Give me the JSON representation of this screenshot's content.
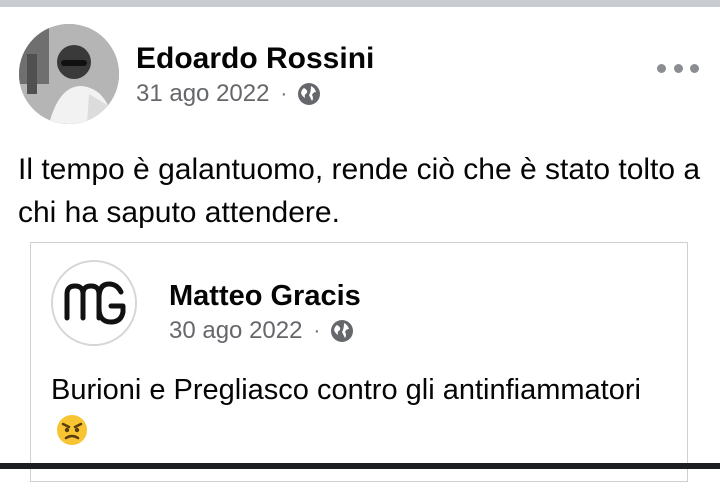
{
  "post": {
    "author": "Edoardo Rossini",
    "date": "31 ago 2022",
    "separator": "·",
    "privacy_icon": "globe-icon",
    "text": "Il tempo è galantuomo, rende ciò che è stato tolto a chi ha saputo attendere.",
    "more_icon": "more-options-icon"
  },
  "shared": {
    "author": "Matteo Gracis",
    "date": "30 ago 2022",
    "separator": "·",
    "privacy_icon": "globe-icon",
    "text": "Burioni e Pregliasco contro gli antinfiammatori",
    "emoji": "angry-face-emoji"
  }
}
